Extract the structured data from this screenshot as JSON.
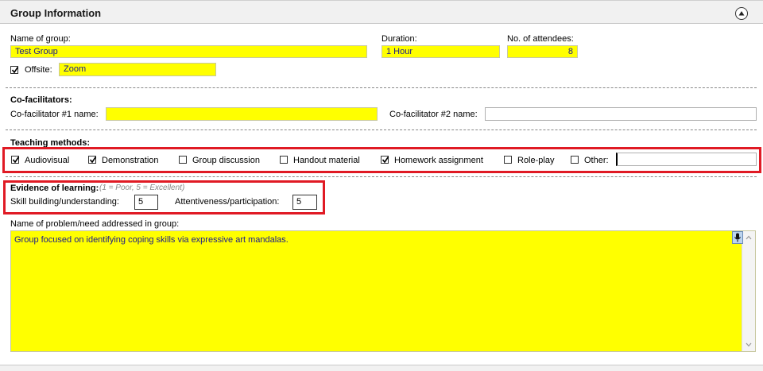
{
  "header": {
    "title": "Group Information"
  },
  "group": {
    "name_label": "Name of group:",
    "name_value": "Test Group",
    "duration_label": "Duration:",
    "duration_value": "1 Hour",
    "attendees_label": "No. of attendees:",
    "attendees_value": "8",
    "offsite_label": "Offsite:",
    "offsite_checked": true,
    "offsite_value": "Zoom"
  },
  "cofacilitators": {
    "title": "Co-facilitators:",
    "cf1_label": "Co-facilitator #1 name:",
    "cf1_value": "",
    "cf2_label": "Co-facilitator #2 name:",
    "cf2_value": ""
  },
  "teaching": {
    "title": "Teaching methods:",
    "methods": [
      {
        "label": "Audiovisual",
        "checked": true
      },
      {
        "label": "Demonstration",
        "checked": true
      },
      {
        "label": "Group discussion",
        "checked": false
      },
      {
        "label": "Handout material",
        "checked": false
      },
      {
        "label": "Homework assignment",
        "checked": true
      },
      {
        "label": "Role-play",
        "checked": false
      },
      {
        "label": "Other:",
        "checked": false
      }
    ],
    "other_value": ""
  },
  "evidence": {
    "title": "Evidence of learning:",
    "scale_hint": "(1 = Poor, 5 = Excellent)",
    "skill_label": "Skill building/understanding:",
    "skill_value": "5",
    "attentiveness_label": "Attentiveness/participation:",
    "attentiveness_value": "5"
  },
  "problem": {
    "label": "Name of problem/need addressed in group:",
    "value": "Group focused on identifying coping skills via expressive art mandalas."
  },
  "colors": {
    "field_yellow": "#ffff00",
    "highlight_red": "#e01a24",
    "field_text": "#1a1a8c"
  }
}
